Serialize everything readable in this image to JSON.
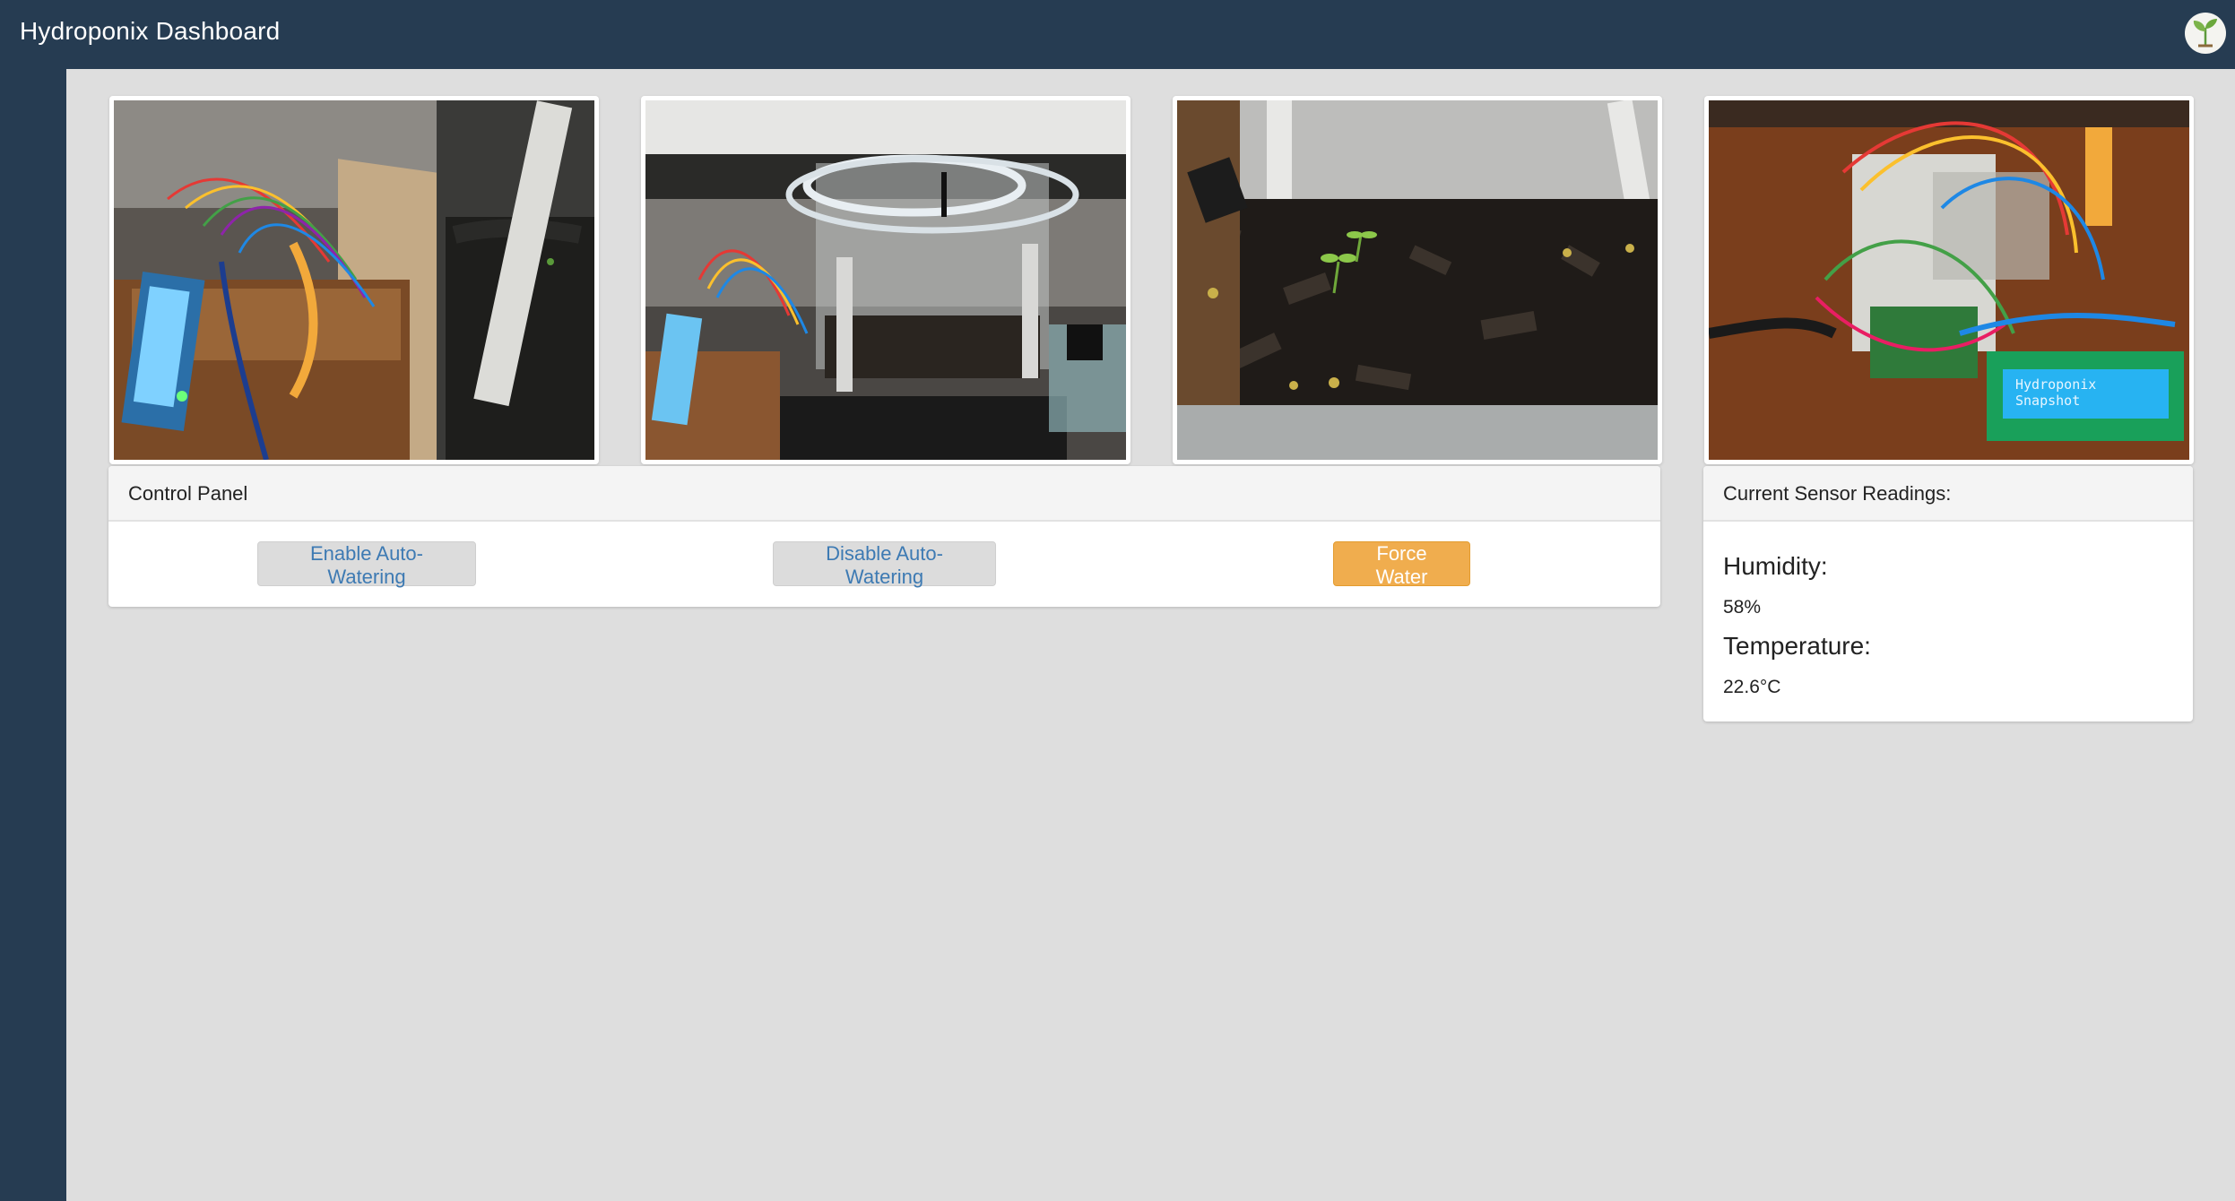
{
  "header": {
    "title": "Hydroponix Dashboard",
    "logo_icon": "leaf-logo-icon"
  },
  "photos": [
    {
      "name": "arduino-lcd-planter-photo",
      "lcd_text": ""
    },
    {
      "name": "reservoir-pump-photo",
      "lcd_text": ""
    },
    {
      "name": "seedlings-soil-photo",
      "lcd_text": ""
    },
    {
      "name": "wiring-board-photo",
      "lcd_text": "Hydroponix Snapshot"
    }
  ],
  "control_panel": {
    "title": "Control Panel",
    "buttons": [
      {
        "label": "Enable Auto-Watering"
      },
      {
        "label": "Disable Auto-Watering"
      },
      {
        "label": "Force Water"
      }
    ]
  },
  "sensors": {
    "title": "Current Sensor Readings:",
    "humidity_label": "Humidity:",
    "humidity_value": "58%",
    "temperature_label": "Temperature:",
    "temperature_value": "22.6°C"
  },
  "colors": {
    "navbar": "#263c52",
    "background": "#dedede",
    "link_blue": "#3d7ab3",
    "warning": "#f0ad4e"
  }
}
